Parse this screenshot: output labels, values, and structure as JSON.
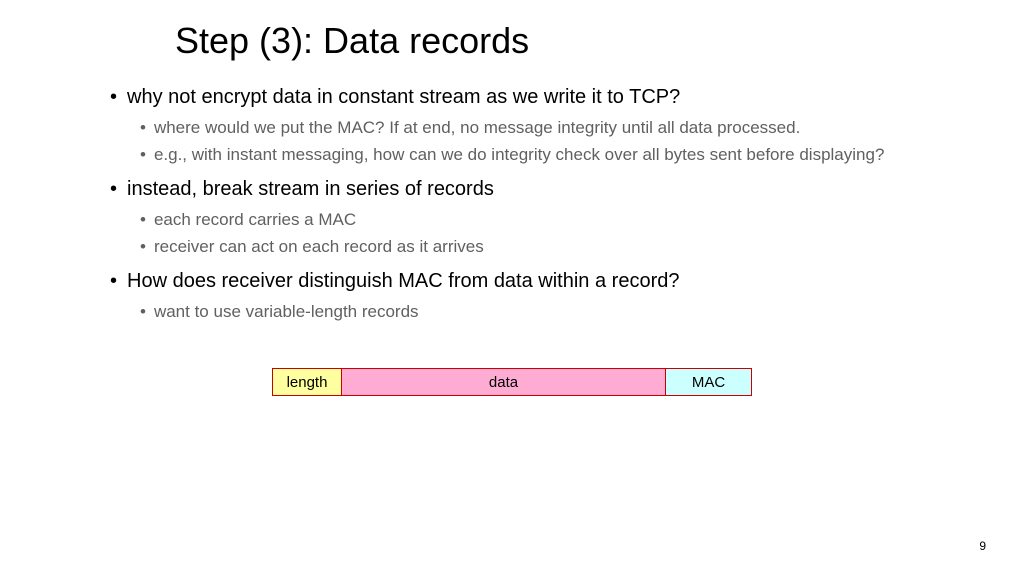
{
  "title": "Step (3): Data records",
  "bullets": {
    "b1": "why not encrypt data in constant stream as we write it to TCP?",
    "b1s1": "where would we put the MAC? If at end, no message integrity until all data processed.",
    "b1s2": "e.g., with instant messaging, how can we do integrity check over all bytes sent before displaying?",
    "b2": "instead, break stream in series of records",
    "b2s1": "each record carries a MAC",
    "b2s2": "receiver can act on each record as it arrives",
    "b3": "How does receiver distinguish MAC from data within a record?",
    "b3s1": "want to use variable-length records"
  },
  "diagram": {
    "length": "length",
    "data": "data",
    "mac": "MAC"
  },
  "page": "9"
}
